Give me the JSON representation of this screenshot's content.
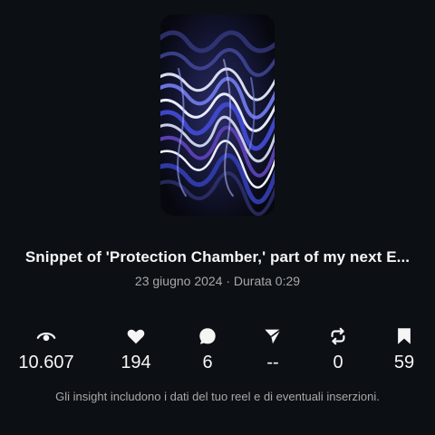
{
  "reel": {
    "thumbnail_icon": "abstract-wave-artwork",
    "title": "Snippet of 'Protection Chamber,' part of my next E...",
    "meta": "23 giugno 2024 · Durata 0:29"
  },
  "stats": [
    {
      "icon": "eye-icon",
      "value": "10.607"
    },
    {
      "icon": "heart-icon",
      "value": "194"
    },
    {
      "icon": "comment-icon",
      "value": "6"
    },
    {
      "icon": "share-icon",
      "value": "--"
    },
    {
      "icon": "repost-icon",
      "value": "0"
    },
    {
      "icon": "bookmark-icon",
      "value": "59"
    }
  ],
  "footer_note": "Gli insight includono i dati del tuo reel e di eventuali inserzioni.",
  "colors": {
    "background": "#0c1014",
    "text": "#f5f5f5",
    "secondary_text": "#a8a8a8"
  }
}
